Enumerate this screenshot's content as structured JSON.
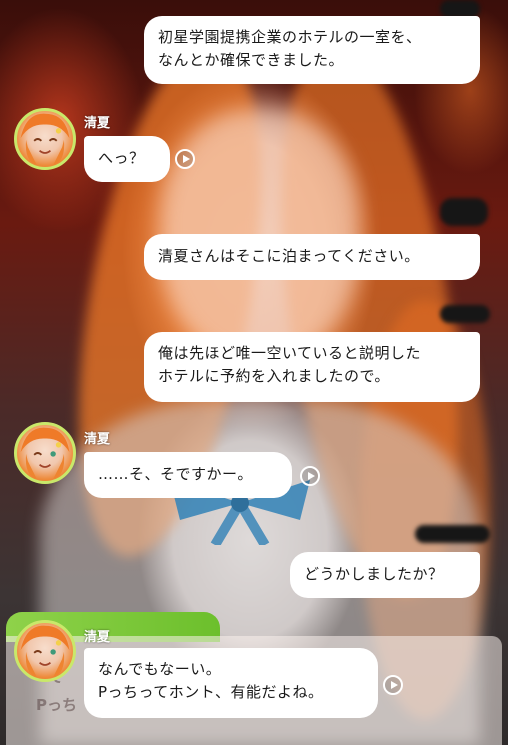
{
  "messages": [
    {
      "side": "right",
      "text": "初星学園提携企業のホテルの一室を、\nなんとか確保できました。"
    },
    {
      "side": "left",
      "speaker": "清夏",
      "text": "へっ？"
    },
    {
      "side": "right",
      "text": "清夏さんはそこに泊まってください。"
    },
    {
      "side": "right",
      "text": "俺は先ほど唯一空いていると説明した\nホテルに予約を入れましたので。"
    },
    {
      "side": "left",
      "speaker": "清夏",
      "text": "……そ、そですかー。"
    },
    {
      "side": "right",
      "text": "どうかしましたか？"
    },
    {
      "side": "left",
      "speaker": "清夏",
      "text": "なんでもなーい。\nPっちってホント、有能だよね。"
    }
  ],
  "faint_text": [
    "て",
    "Pっち"
  ],
  "colors": {
    "bubble": "#ffffff",
    "name_text": "#ffffff",
    "avatar_ring": "#c9e86a",
    "speaker_tab": "#7ccb3a"
  },
  "icons": {
    "voice_play": "play-circle-icon"
  }
}
